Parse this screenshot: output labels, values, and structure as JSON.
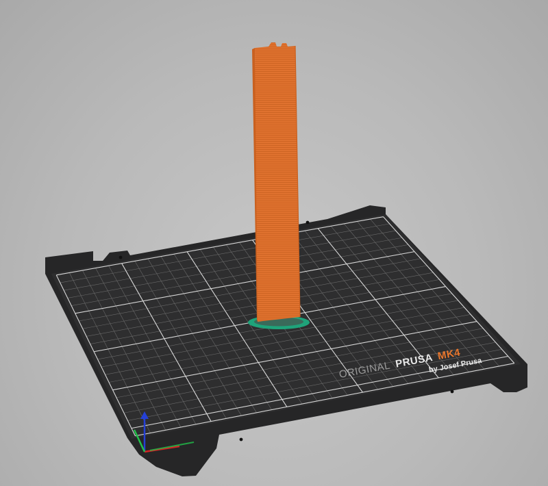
{
  "app": {
    "view": "3D preview"
  },
  "bed": {
    "brand_original": "ORIGINAL",
    "brand_prusa": "PRUSA",
    "model": "MK4",
    "byline": "by Josef Prusa",
    "colors": {
      "plate": "#2e2e2f",
      "plate_frame": "#262627",
      "grid_minor": "#6a6a6a",
      "grid_major": "#d8d8d8",
      "brand_text": "#9a9a9a",
      "brand_bold": "#e8e8e8",
      "model_accent": "#e8772e"
    }
  },
  "object": {
    "color": "#e0722f",
    "shade": "#c9601f",
    "brim_color": "#1fa37a"
  },
  "axes": {
    "x_color": "#d22424",
    "y_color": "#22c04a",
    "z_color": "#2440d6"
  }
}
